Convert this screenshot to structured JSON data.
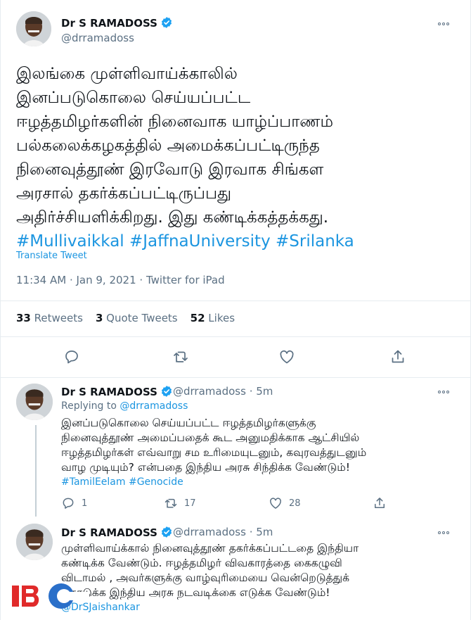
{
  "tweet": {
    "author_name": "Dr S RAMADOSS",
    "author_handle": "@drramadoss",
    "text_lines": [
      "இலங்கை முள்ளிவாய்க்காலில்",
      "இனப்படுகொலை செய்யப்பட்ட",
      "ஈழத்தமிழர்களின் நினைவாக யாழ்ப்பாணம்",
      "பல்கலைக்கழகத்தில் அமைக்கப்பட்டிருந்த",
      "நினைவுத்தூண் இரவோடு இரவாக சிங்கள",
      "அரசால் தகர்க்கப்பட்டிருப்பது",
      "அதிர்ச்சியளிக்கிறது. இது  கண்டிக்கத்தக்கது."
    ],
    "hashtags": "#Mullivaikkal #JaffnaUniversity #Srilanka",
    "translate_label": "Translate Tweet",
    "meta": "11:34 AM · Jan 9, 2021 · Twitter for iPad",
    "stats": {
      "retweets_count": "33",
      "retweets_label": "Retweets",
      "quotes_count": "3",
      "quotes_label": "Quote Tweets",
      "likes_count": "52",
      "likes_label": "Likes"
    },
    "actions": [
      "reply-icon",
      "retweet-icon",
      "like-icon",
      "share-icon"
    ]
  },
  "replies": [
    {
      "author_name": "Dr S RAMADOSS",
      "author_handle": "@drramadoss",
      "time": "· 5m",
      "replying_label": "Replying to",
      "replying_handle": "@drramadoss",
      "text_lines": [
        "இனப்படுகொலை செய்யப்பட்ட ஈழத்தமிழர்களுக்கு",
        "நினைவுத்தூண் அமைப்பதைக் கூட அனுமதிக்காக ஆட்சியில்",
        "ஈழத்தமிழர்கள் எவ்வாறு சம உரிமையுடனும், கவுரவத்துடனும்",
        "வாழ முடியும்? என்பதை இந்திய அரசு சிந்திக்க வேண்டும்!"
      ],
      "hashtags": "#TamilEelam #Genocide",
      "reply_count": "1",
      "retweet_count": "17",
      "like_count": "28"
    },
    {
      "author_name": "Dr S RAMADOSS",
      "author_handle": "@drramadoss",
      "time": "· 5m",
      "text_lines": [
        "முள்ளிவாய்க்கால் நினைவுத்தூண் தகர்க்கப்பட்டதை இந்தியா",
        "கண்டிக்க வேண்டும். ஈழத்தமிழர் விவகாரத்தை கைகழுவி",
        "விடாமல் ,  அவர்களுக்கு வாழ்வுரிமையை வென்றெடுத்துக்",
        "கொடுக்க இந்திய அரசு நடவடிக்கை எடுக்க வேண்டும்!"
      ],
      "mention": "@DrSJaishankar"
    }
  ],
  "watermark": {
    "text": "IBC",
    "color_red": "#e02a2a",
    "color_blue": "#2a6fc9"
  },
  "colors": {
    "link": "#1b95e0",
    "verified": "#1da1f2",
    "secondary": "#5b7083",
    "divider": "#e6ecf0"
  }
}
